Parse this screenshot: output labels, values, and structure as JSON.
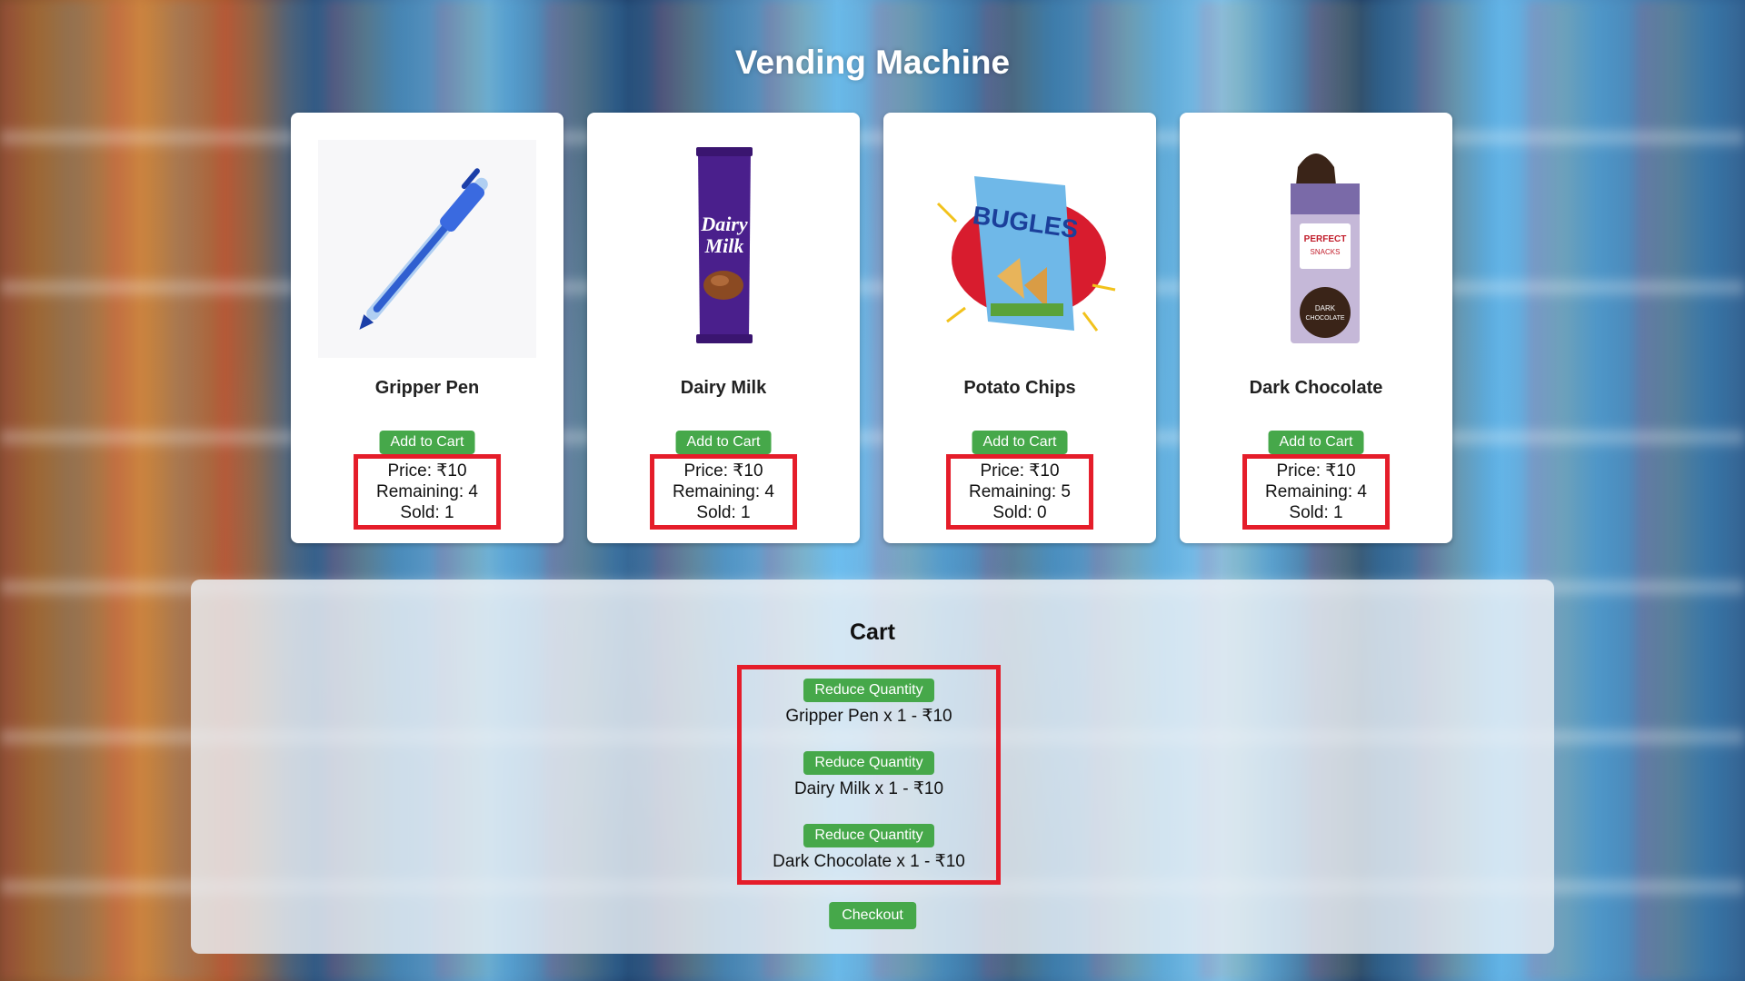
{
  "title": "Vending Machine",
  "products": [
    {
      "name": "Gripper Pen",
      "add_label": "Add to Cart",
      "price": "Price: ₹10",
      "remaining": "Remaining: 4",
      "sold": "Sold: 1",
      "icon": "pen-image"
    },
    {
      "name": "Dairy Milk",
      "add_label": "Add to Cart",
      "price": "Price: ₹10",
      "remaining": "Remaining: 4",
      "sold": "Sold: 1",
      "icon": "chocolate-bar-image"
    },
    {
      "name": "Potato Chips",
      "add_label": "Add to Cart",
      "price": "Price: ₹10",
      "remaining": "Remaining: 5",
      "sold": "Sold: 0",
      "icon": "chips-bag-image"
    },
    {
      "name": "Dark Chocolate",
      "add_label": "Add to Cart",
      "price": "Price: ₹10",
      "remaining": "Remaining: 4",
      "sold": "Sold: 1",
      "icon": "snack-bar-image"
    }
  ],
  "cart": {
    "title": "Cart",
    "items": [
      {
        "reduce_label": "Reduce Quantity",
        "text": "Gripper Pen x 1 - ₹10"
      },
      {
        "reduce_label": "Reduce Quantity",
        "text": "Dairy Milk x 1 - ₹10"
      },
      {
        "reduce_label": "Reduce Quantity",
        "text": "Dark Chocolate x 1 - ₹10"
      }
    ],
    "checkout_label": "Checkout"
  },
  "colors": {
    "button_green": "#46a84a",
    "highlight_red": "#e51d2a"
  }
}
